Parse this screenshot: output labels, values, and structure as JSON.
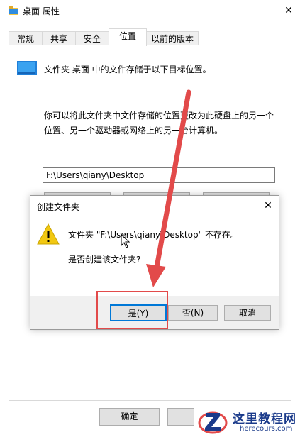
{
  "window": {
    "title": "桌面 属性",
    "close_glyph": "✕"
  },
  "tabs": [
    {
      "label": "常规"
    },
    {
      "label": "共享"
    },
    {
      "label": "安全"
    },
    {
      "label": "位置"
    },
    {
      "label": "以前的版本"
    }
  ],
  "active_tab": "位置",
  "location": {
    "title": "文件夹 桌面 中的文件存储于以下目标位置。",
    "desc_line1": "你可以将此文件夹中文件存储的位置更改为此硬盘上的另一个",
    "desc_line2": "位置、另一个驱动器或网络上的另一台计算机。",
    "path_value": "F:\\Users\\qiany\\Desktop"
  },
  "footer": {
    "ok_label": "确定",
    "cancel_label": "取"
  },
  "dialog": {
    "title": "创建文件夹",
    "close_glyph": "✕",
    "message": "文件夹 \"F:\\Users\\qiany\\Desktop\" 不存在。",
    "question": "是否创建该文件夹?",
    "yes_label": "是(Y)",
    "no_label": "否(N)",
    "cancel_label": "取消"
  },
  "watermark": {
    "text": "这里教程网",
    "url": "herecours.com"
  },
  "colors": {
    "annotation_red": "#e24a4a",
    "focus_blue": "#0078d7",
    "watermark_blue": "#1a3a8a",
    "warning_yellow": "#f2c811"
  },
  "icons": {
    "title": "folder-icon",
    "location": "desktop-folder-icon",
    "dialog": "warning-icon",
    "cursor": "mouse-cursor-icon"
  }
}
